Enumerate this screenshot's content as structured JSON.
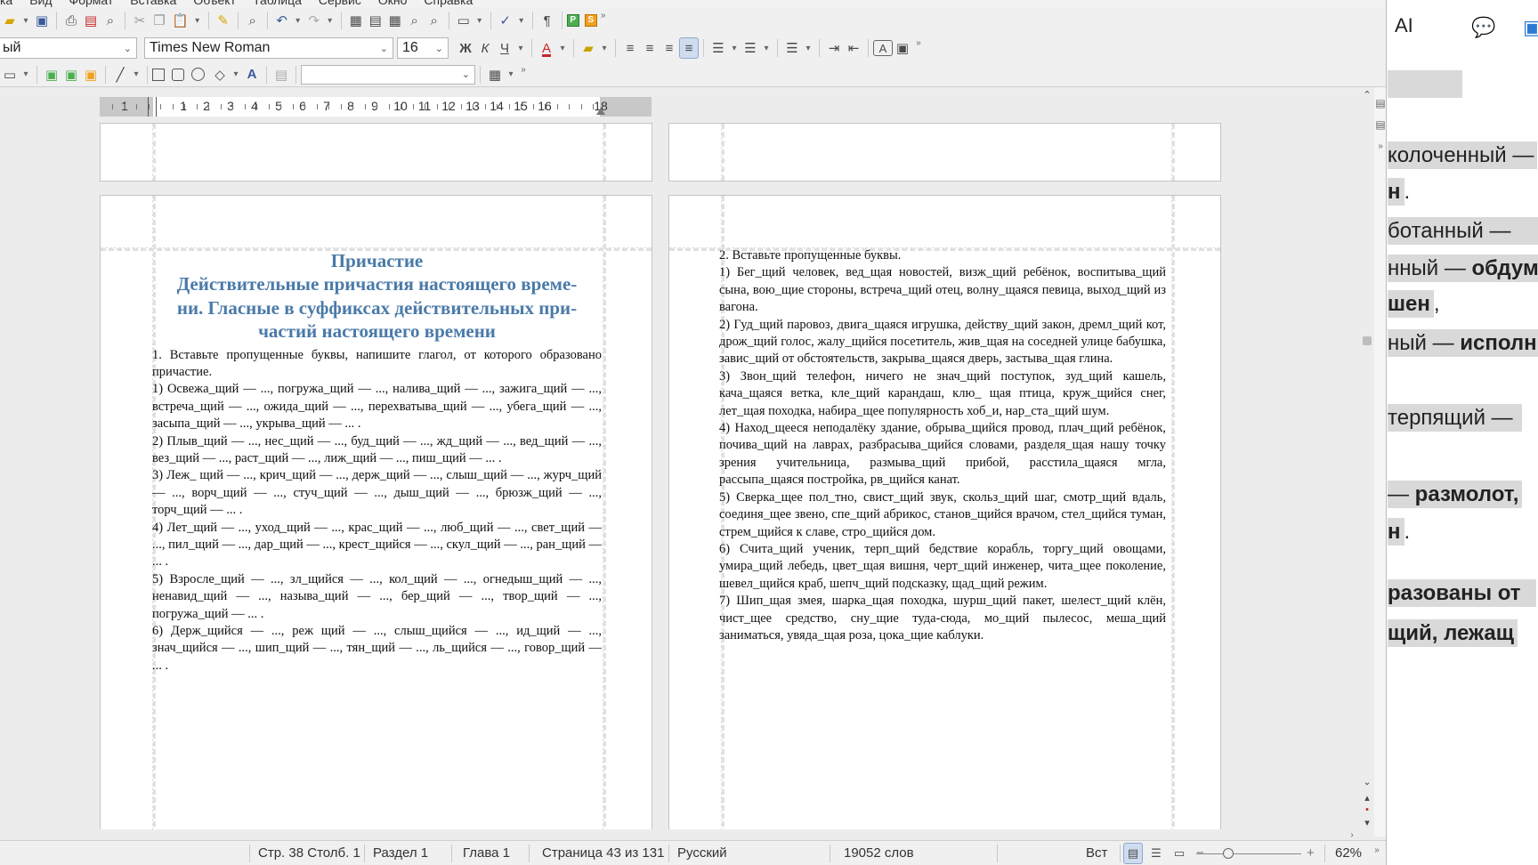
{
  "menubar": {
    "items": [
      "ка",
      "Вид",
      "Формат",
      "Вставка",
      "Объект",
      "Таблица",
      "Сервис",
      "Окно",
      "Справка"
    ]
  },
  "toolbar": {
    "paragraph_style": "ый",
    "font_name": "Times New Roman",
    "font_size": "16",
    "bold": "Ж",
    "italic": "К",
    "underline": "Ч",
    "font_color_glyph": "A",
    "format_glyph": "A",
    "pilcrow": "¶",
    "more": "»"
  },
  "ruler": {
    "labels": [
      "1",
      "1",
      "2",
      "3",
      "4",
      "5",
      "6",
      "7",
      "8",
      "9",
      "10",
      "11",
      "12",
      "13",
      "14",
      "15",
      "16",
      "18"
    ]
  },
  "left_page": {
    "title_lines": [
      "Причастие",
      "Действительные причастия настоящего време-",
      "ни. Гласные в суффиксах действительных при-",
      "частий настоящего времени"
    ],
    "paragraphs": [
      "1. Вставьте пропущенные буквы, напишите глагол, от которого образовано причастие.",
      "1) Освежа_щий — ..., погружа_щий — ..., налива_щий — ..., зажига_щий — ..., встреча_щий — ..., ожида_щий — ..., перехватыва_щий — ..., убега_щий — ..., засыпа_щий — ..., укрыва_щий — ... .",
      "2) Плыв_щий — ..., нес_щий — ..., буд_щий — ..., жд_щий — ..., вед_щий — ..., вез_щий — ..., раст_щий — ..., лиж_щий — ..., пиш_щий — ... .",
      "3) Леж_ щий — ..., крич_щий — ..., держ_щий — ..., слыш_щий — ..., журч_щий — ..., ворч_щий — ..., стуч_щий — ..., дыш_щий — ..., брюзж_щий — ..., торч_щий — ... .",
      "4) Лет_щий — ..., уход_щий — ..., крас_щий — ..., люб_щий — ..., свет_щий — ..., пил_щий — ..., дар_щий — ..., крест_щийся — ..., скул_щий — ..., ран_щий — ... .",
      "5) Взросле_щий — ..., зл_щийся — ..., кол_щий — ..., огнедыш_щий — ..., ненавид_щий — ..., называ_щий — ..., бер_щий — ..., твор_щий — ..., погружа_щий — ... .",
      "6) Держ_щийся — ..., реж щий — ..., слыш_щийся — ..., ид_щий — ..., знач_щийся — ..., шип_щий — ..., тян_щий — ..., ль_щийся — ..., говор_щий — ... ."
    ]
  },
  "right_page": {
    "paragraphs": [
      "2. Вставьте пропущенные буквы.",
      "1) Бег_щий человек, вед_щая новостей, визж_щий ребёнок, воспитыва_щий сына, вою_щие стороны, встреча_щий отец, волну_щаяся певица, выход_щий из вагона.",
      "2) Гуд_щий паровоз, двига_щаяся игрушка, действу_щий закон, дремл_щий кот, дрож_щий голос, жалу_щийся посетитель, жив_щая на соседней улице бабушка, завис_щий от обстоятельств, закрыва_щаяся дверь, застыва_щая глина.",
      "3) Звон_щий телефон, ничего не знач_щий поступок, зуд_щий кашель, кача_щаяся ветка, кле_щий карандаш, клю_ щая птица, круж_щийся снег, лет_щая походка, набира_щее популярность хоб_и, нар_ста_щий шум.",
      "4) Наход_щееся неподалёку здание, обрыва_щийся провод, плач_щий ребёнок, почива_щий на лаврах, разбрасыва_щийся словами, разделя_щая нашу точку зрения учительница, размыва_щий прибой, расстила_щаяся мгла, рассыпа_щаяся постройка, рв_щийся канат.",
      "5) Сверка_щее пол_тно, свист_щий звук, скольз_щий шаг, смотр_щий вдаль, соединя_щее звено, спе_щий абрикос, станов_щийся врачом, стел_щийся туман, стрем_щийся к славе, стро_щийся дом.",
      "6) Счита_щий ученик, терп_щий бедствие корабль, торгу_щий овощами, умира_щий лебедь, цвет_щая вишня, черт_щий инженер, чита_щее поколение, шевел_щийся краб, шепч_щий подсказку, щад_щий режим.",
      "7) Шип_щая змея, шарка_щая походка, шурш_щий пакет, шелест_щий клён, чист_щее средство, сну_щие туда-сюда, мо_щий пылесос, меша_щий заниматься, увяда_щая роза, цока_щие каблуки."
    ]
  },
  "statusbar": {
    "position": "Стр. 38 Столб. 1",
    "section": "Раздел 1",
    "chapter": "Глава 1",
    "page": "Страница 43 из 131",
    "language": "Русский",
    "words": "19052 слов",
    "insert_mode": "Вст",
    "zoom_minus": "−",
    "zoom_plus": "+",
    "zoom": "62%"
  },
  "right_panel": {
    "ai_label": "AI",
    "lines": [
      {
        "plain": "колоченный —",
        "bold": ""
      },
      {
        "plain": "",
        "bold": "н"
      },
      {
        "plain": "ботанный —",
        "bold": ""
      },
      {
        "plain": "нный — ",
        "bold": "обдум"
      },
      {
        "plain": "",
        "bold": "шен"
      },
      {
        "plain": "ный — ",
        "bold": "исполн"
      },
      {
        "plain": "терпящий —",
        "bold": ""
      },
      {
        "plain": "— ",
        "bold": "размолот,"
      },
      {
        "plain": "",
        "bold": "н"
      },
      {
        "plain": "",
        "bold": "разованы от"
      },
      {
        "plain": "",
        "bold": "щий, лежащ"
      }
    ],
    "suffix_dot": ".",
    "suffix_comma": ","
  }
}
